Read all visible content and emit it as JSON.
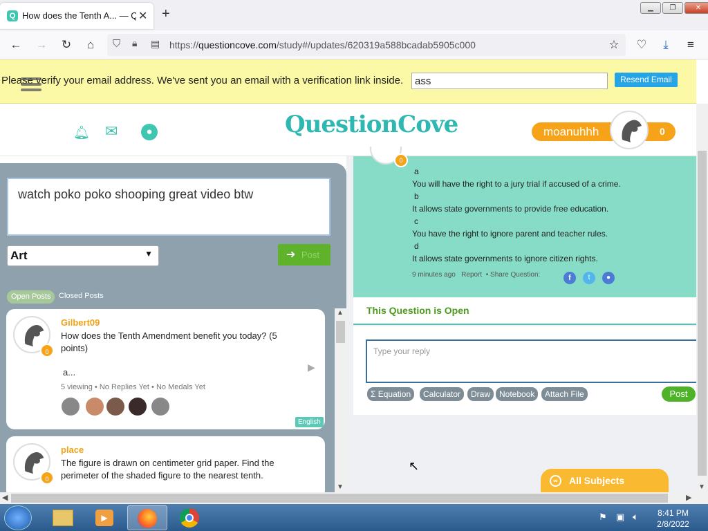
{
  "browser": {
    "tab_title": "How does the Tenth A... — Que",
    "url_prefix": "https://",
    "url_domain": "questioncove.com",
    "url_path": "/study#/updates/620319a588bcadab5905c000"
  },
  "banner": {
    "text": "Please verify your email address. We've sent you an email with a verification link inside.",
    "input_value": "ass",
    "resend_label": "Resend Email"
  },
  "header": {
    "logo": "QuestionCove",
    "username": "moanuhhh",
    "points": "0"
  },
  "composer": {
    "text": "watch poko poko shooping great video btw",
    "subject": "Art",
    "post_label": "Post"
  },
  "tabs": {
    "open": "Open Posts",
    "closed": "Closed Posts"
  },
  "cards": [
    {
      "user": "Gilbert09",
      "badge": "0",
      "question": "How does the Tenth Amendment benefit you today? (5 points)",
      "snippet": "a...",
      "meta": "5 viewing  •  No Replies Yet  •  No Medals Yet",
      "language": "English"
    },
    {
      "user": "place",
      "badge": "0",
      "question": "The figure is drawn on centimeter grid paper. Find the perimeter of the shaded figure to the nearest tenth."
    }
  ],
  "question": {
    "badge": "0",
    "lines": [
      "a",
      "You will have the right to a jury trial if accused of a crime.",
      "b",
      "It allows state governments to provide free education.",
      "c",
      "You have the right to ignore parent and teacher rules.",
      "d",
      "It allows state governments to ignore citizen rights."
    ],
    "time": "9 minutes ago",
    "report": "Report",
    "share": "Share Question:"
  },
  "reply": {
    "status": "This Question is Open",
    "placeholder": "Type your reply",
    "tools": [
      "Σ  Equation",
      "Calculator",
      "Draw",
      "Notebook",
      "Attach File"
    ],
    "post_label": "Post"
  },
  "all_subjects": "All Subjects",
  "taskbar": {
    "time": "8:41 PM",
    "date": "2/8/2022"
  },
  "colors": {
    "accent": "#2fb8b2",
    "orange": "#f7a319",
    "green": "#4fb32a",
    "question_bg": "#86dcc6"
  }
}
